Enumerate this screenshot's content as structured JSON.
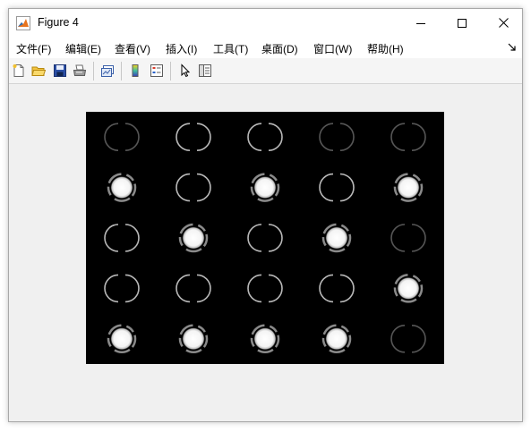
{
  "window": {
    "title": "Figure 4",
    "icon": "matlab-logo-icon",
    "controls": [
      "minimize-icon",
      "maximize-icon",
      "close-icon"
    ]
  },
  "menu": {
    "items": [
      {
        "label": "文件(F)"
      },
      {
        "label": "编辑(E)"
      },
      {
        "label": "查看(V)"
      },
      {
        "label": "插入(I)"
      },
      {
        "label": "工具(T)"
      },
      {
        "label": "桌面(D)"
      },
      {
        "label": "窗口(W)"
      },
      {
        "label": "帮助(H)"
      }
    ],
    "dock_icon": "dock-arrow-icon"
  },
  "toolbar": {
    "buttons": [
      "new-figure-icon",
      "open-file-icon",
      "save-icon",
      "print-icon",
      "link-plot-icon",
      "insert-colorbar-icon",
      "insert-legend-icon",
      "edit-plot-pointer-icon",
      "property-inspector-icon"
    ]
  },
  "figure": {
    "content": "grayscale image montage, 5 x 5 grid",
    "grid": {
      "rows": 5,
      "cols": 5
    },
    "cells": [
      [
        "ring-faint",
        "ring",
        "ring",
        "ring-faint",
        "ring-faint"
      ],
      [
        "filled",
        "ring",
        "filled",
        "ring",
        "filled"
      ],
      [
        "ring",
        "filled",
        "ring",
        "filled",
        "ring-faint"
      ],
      [
        "ring",
        "ring",
        "ring",
        "ring",
        "filled"
      ],
      [
        "filled",
        "filled",
        "filled",
        "filled",
        "ring-faint"
      ]
    ],
    "colors": {
      "background": "#000000",
      "foreground": "#ffffff"
    }
  }
}
